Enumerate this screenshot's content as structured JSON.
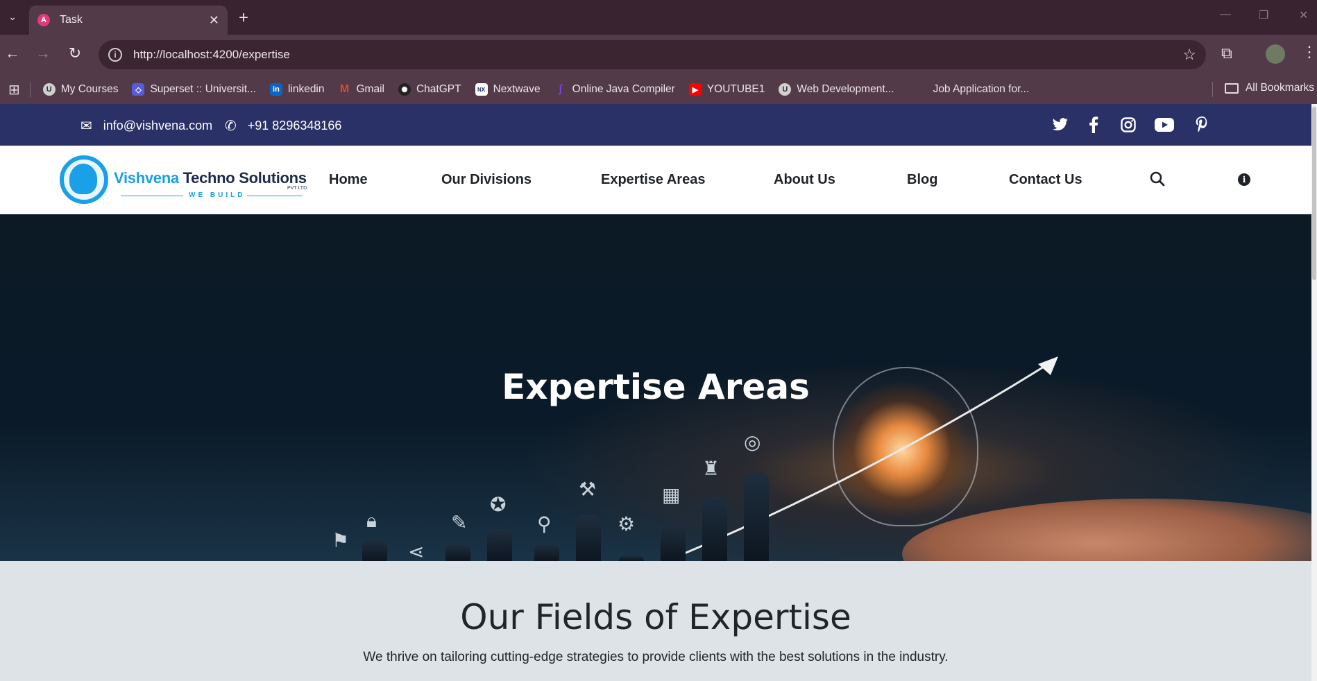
{
  "browser": {
    "tab_title": "Task",
    "url": "http://localhost:4200/expertise",
    "bookmarks": [
      {
        "label": "My Courses",
        "color": "#d0d0d0"
      },
      {
        "label": "Superset :: Universit...",
        "color": "#5a5adc"
      },
      {
        "label": "linkedin",
        "color": "#0a66c2"
      },
      {
        "label": "Gmail",
        "color": "#ea4335"
      },
      {
        "label": "ChatGPT",
        "color": "#222222"
      },
      {
        "label": "Nextwave",
        "color": "#1a2a6a"
      },
      {
        "label": "Online Java Compiler",
        "color": "#7b3fe4"
      },
      {
        "label": "YOUTUBE1",
        "color": "#ff0000"
      },
      {
        "label": "Web Development...",
        "color": "#d0d0d0"
      },
      {
        "label": "Job Application for...",
        "color": ""
      }
    ],
    "all_bookmarks": "All Bookmarks"
  },
  "topbar": {
    "email": "info@vishvena.com",
    "phone": "+91 8296348166",
    "social": [
      "twitter-icon",
      "facebook-icon",
      "instagram-icon",
      "youtube-icon",
      "pinterest-icon"
    ],
    "bg_color": "#2a3167"
  },
  "logo": {
    "brand_first": "Vishvena",
    "brand_rest": " Techno Solutions",
    "tagline": "WE BUILD",
    "suffix": "PVT LTD."
  },
  "nav": {
    "home": "Home",
    "divisions": "Our Divisions",
    "expertise": "Expertise Areas",
    "about": "About Us",
    "blog": "Blog",
    "contact": "Contact Us"
  },
  "hero": {
    "title": "Expertise Areas"
  },
  "fields": {
    "heading": "Our Fields of Expertise",
    "subtitle": "We thrive on tailoring cutting-edge strategies to provide clients with the best solutions in the industry."
  }
}
